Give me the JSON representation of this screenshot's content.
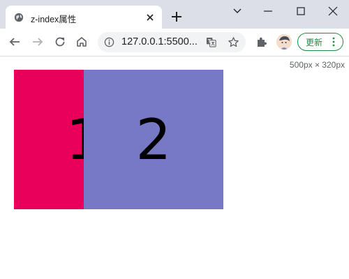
{
  "tab": {
    "title": "z-index属性"
  },
  "toolbar": {
    "url": "127.0.0.1:5500...",
    "update_label": "更新"
  },
  "page": {
    "size_readout": "500px × 320px",
    "boxes": [
      {
        "label": "1",
        "color": "#e8005a"
      },
      {
        "label": "2",
        "color": "#7779c7"
      }
    ]
  },
  "colors": {
    "tabstrip": "#dcdfe6",
    "update_accent": "#1e8e3e"
  },
  "icons": [
    "globe-icon",
    "close-icon",
    "plus-icon",
    "chevron-down-icon",
    "minimize-icon",
    "maximize-icon",
    "close-window-icon",
    "back-icon",
    "forward-icon",
    "reload-icon",
    "home-icon",
    "info-icon",
    "translate-icon",
    "star-icon",
    "extensions-icon",
    "kebab-menu-icon"
  ]
}
